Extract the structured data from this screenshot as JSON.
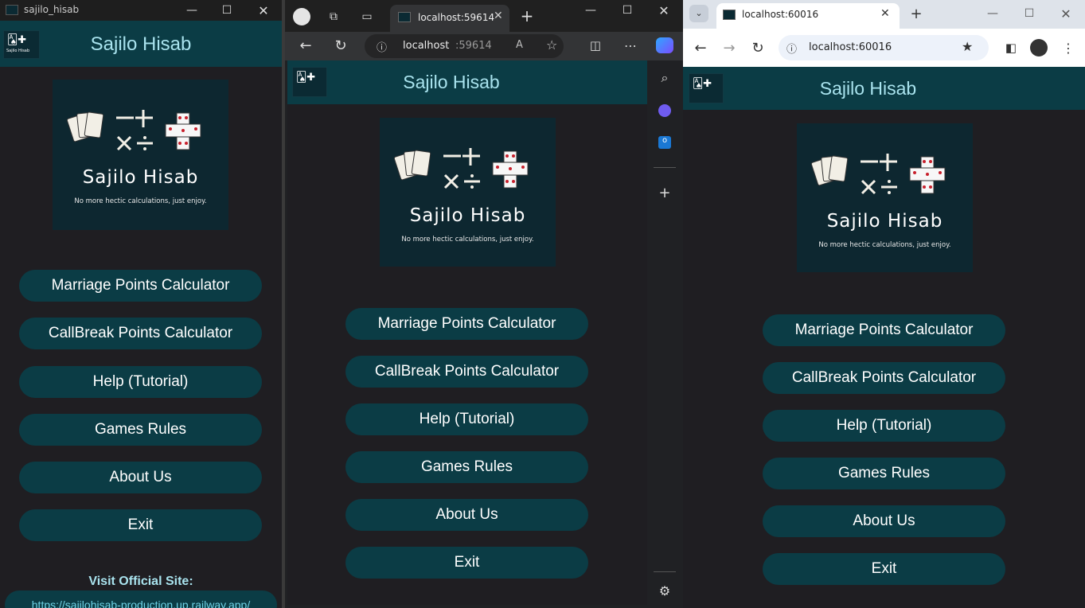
{
  "app": {
    "title": "Sajilo Hisab",
    "logo_title": "Sajilo Hisab",
    "logo_tagline": "No more hectic calculations, just enjoy.",
    "menu": [
      "Marriage Points Calculator",
      "CallBreak Points Calculator",
      "Help (Tutorial)",
      "Games Rules",
      "About Us",
      "Exit"
    ],
    "visit_label": "Visit Official Site:",
    "visit_url": "https://sajilohisab-production.up.railway.app/"
  },
  "win1": {
    "title": "sajilo_hisab"
  },
  "edge": {
    "tab_title": "localhost:59614",
    "url_host": "localhost",
    "url_port": ":59614"
  },
  "chrome": {
    "tab_title": "localhost:60016",
    "url": "localhost:60016"
  },
  "colors": {
    "header": "#0b3c45",
    "title_text": "#a9e3ee",
    "app_bg": "#1f1e22",
    "button": "#0b3c45"
  }
}
